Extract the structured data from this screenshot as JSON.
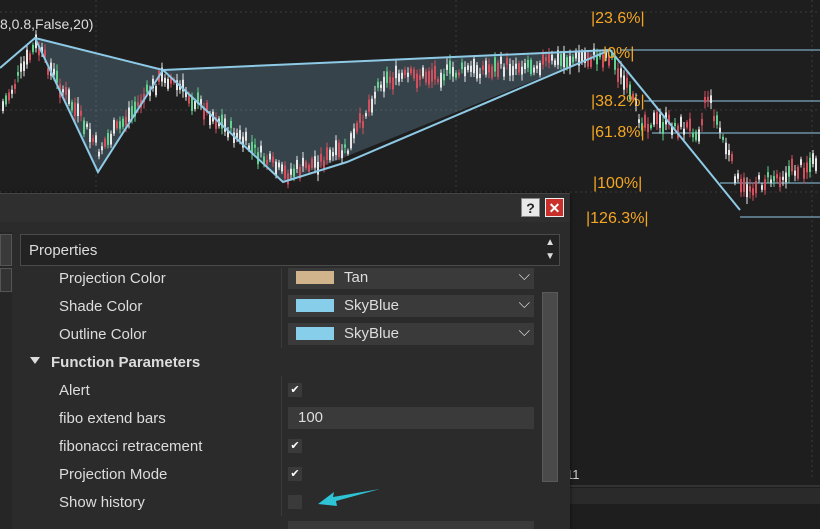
{
  "indicator_label": "8,0.8,False,20)",
  "x_axis_label": "11",
  "fib_levels": [
    "|23.6%|",
    "|0%|",
    "|38.2%|",
    "|61.8%|",
    "|100%|",
    "|126.3%|"
  ],
  "dialog": {
    "help_label": "?",
    "close_label": "✕",
    "properties_header": "Properties",
    "rows": {
      "projection_color": {
        "name": "Projection Color",
        "value": "Tan",
        "color": "#d2b48c"
      },
      "shade_color": {
        "name": "Shade Color",
        "value": "SkyBlue",
        "color": "#87ceeb"
      },
      "outline_color": {
        "name": "Outline Color",
        "value": "SkyBlue",
        "color": "#87ceeb"
      },
      "section": {
        "name": "Function Parameters"
      },
      "alert": {
        "name": "Alert",
        "checked": true
      },
      "fibo_extend_bars": {
        "name": "fibo extend bars",
        "value": "100"
      },
      "fibonacci_retracement": {
        "name": "fibonacci retracement",
        "checked": true
      },
      "projection_mode": {
        "name": "Projection Mode",
        "checked": true
      },
      "show_history": {
        "name": "Show history",
        "checked": false
      }
    }
  },
  "colors": {
    "fib_text": "#f5a623",
    "pattern_line": "#8ecae6",
    "candle_up": "#e6e6e6",
    "candle_down": "#d2505e",
    "candle_green": "#5fd38d",
    "arrow": "#2ec4d6"
  }
}
